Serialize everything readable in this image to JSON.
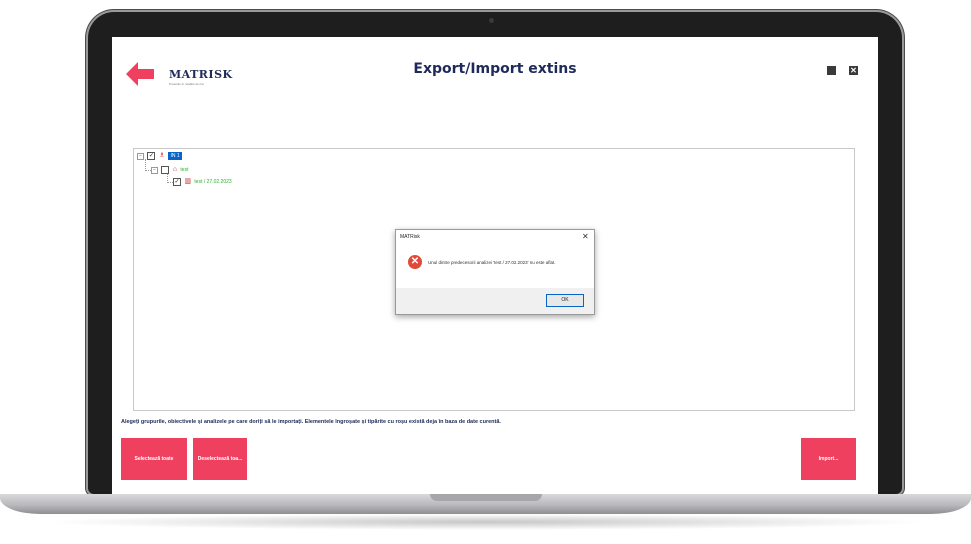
{
  "app": {
    "title": "Export/Import extins",
    "logo_text": "MATRISK",
    "logo_tagline": "Protecție în relațiile de risc"
  },
  "tree": {
    "root": {
      "label": "IN 1"
    },
    "group": {
      "label": "test"
    },
    "analysis": {
      "label": "test / 27.02.2023"
    }
  },
  "dialog": {
    "title": "MATRisk",
    "message": "Unul dintre predecesorii analizei 'test / 27.02.2023' nu este aflat.",
    "ok_label": "OK"
  },
  "instructions": "Alegeți grupurile, obiectivele și analizele pe care doriți să le importați. Elementele îngroșate și tipărite cu roșu există deja în baza de date curentă.",
  "buttons": {
    "select_all": "Selectează toate",
    "deselect_all": "Deselectează toa...",
    "import": "Import..."
  },
  "colors": {
    "accent_red": "#ef4060",
    "title_navy": "#1f2a5a",
    "selection_blue": "#0a64c8",
    "tree_green": "#2db02d"
  }
}
